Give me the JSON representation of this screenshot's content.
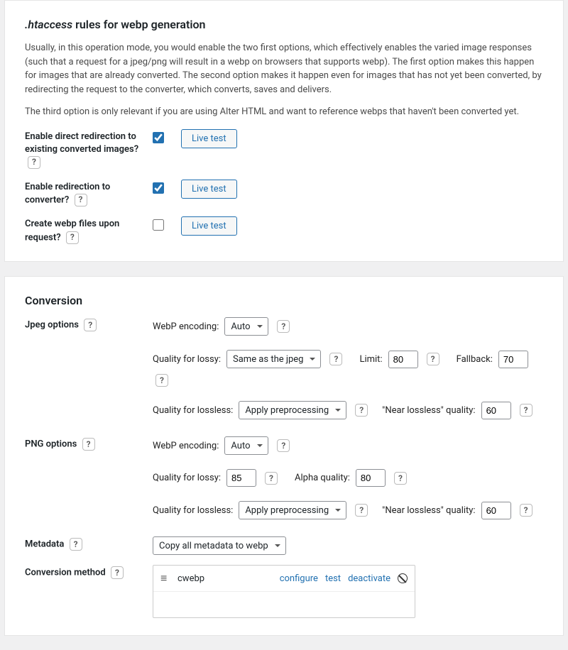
{
  "htaccess": {
    "title_prefix": ".htaccess",
    "title_rest": " rules for webp generation",
    "para1": "Usually, in this operation mode, you would enable the two first options, which effectively enables the varied image responses (such that a request for a jpeg/png will result in a webp on browsers that supports webp). The first option makes this happen for images that are already converted. The second option makes it happen even for images that has not yet been converted, by redirecting the request to the converter, which converts, saves and delivers.",
    "para2": "The third option is only relevant if you are using Alter HTML and want to reference webps that haven't been converted yet.",
    "opt1_label": "Enable direct redirection to existing converted images?",
    "opt2_label": "Enable redirection to converter?",
    "opt3_label": "Create webp files upon request?",
    "live_test": "Live test"
  },
  "conversion": {
    "title": "Conversion",
    "jpeg_label": "Jpeg options",
    "png_label": "PNG options",
    "metadata_label": "Metadata",
    "method_label": "Conversion method",
    "webp_encoding_label": "WebP encoding:",
    "webp_encoding_value": "Auto",
    "q_lossy_label": "Quality for lossy:",
    "q_lossy_jpeg_value": "Same as the jpeg",
    "limit_label": "Limit:",
    "limit_value": "80",
    "fallback_label": "Fallback:",
    "fallback_value": "70",
    "q_lossless_label": "Quality for lossless:",
    "q_lossless_value": "Apply preprocessing",
    "near_lossless_label": "\"Near lossless\" quality:",
    "near_lossless_jpeg": "60",
    "near_lossless_png": "60",
    "png_q_lossy_value": "85",
    "alpha_q_label": "Alpha quality:",
    "alpha_q_value": "80",
    "metadata_value": "Copy all metadata to webp",
    "method_name": "cwebp",
    "configure": "configure",
    "test": "test",
    "deactivate": "deactivate"
  }
}
